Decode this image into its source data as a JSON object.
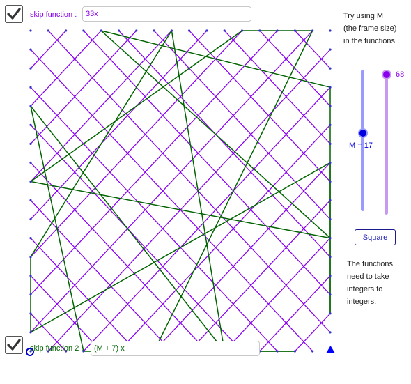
{
  "skip_function_1": {
    "label": "skip function : ",
    "value": "33x",
    "checked": true,
    "color": "#8a00ee"
  },
  "skip_function_2": {
    "label": "skip function 2 : ",
    "value": "(M + 7) x",
    "checked": true,
    "color": "#006400"
  },
  "info": {
    "lines": [
      "Try using M",
      "(the frame size)",
      "in the functions."
    ]
  },
  "slider_M": {
    "label": "M = 17",
    "value": 17,
    "color": "#0000e0",
    "track_color": "#9a9aff",
    "level": 0.41
  },
  "slider_count": {
    "label": "68",
    "value": 68,
    "color": "#8a00ee",
    "track_color": "#c79aef",
    "level": 1.0
  },
  "square_button": {
    "label": "Square"
  },
  "note": {
    "lines": [
      "The functions",
      "need to take",
      "integers to",
      "integers."
    ]
  },
  "colors": {
    "purple": "#8a00ee",
    "green": "#006400",
    "point": "#3333cc",
    "marker": "#0000ff"
  }
}
